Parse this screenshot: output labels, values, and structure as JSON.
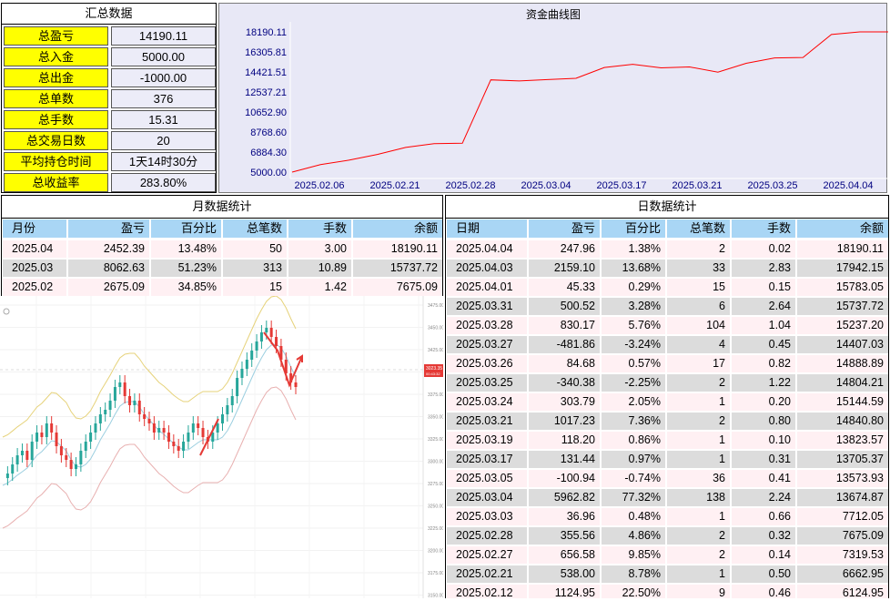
{
  "summary": {
    "title": "汇总数据",
    "rows": [
      {
        "label": "总盈亏",
        "value": "14190.11"
      },
      {
        "label": "总入金",
        "value": "5000.00"
      },
      {
        "label": "总出金",
        "value": "-1000.00"
      },
      {
        "label": "总单数",
        "value": "376"
      },
      {
        "label": "总手数",
        "value": "15.31"
      },
      {
        "label": "总交易日数",
        "value": "20"
      },
      {
        "label": "平均持仓时间",
        "value": "1天14时30分"
      },
      {
        "label": "总收益率",
        "value": "283.80%"
      }
    ]
  },
  "chart_data": {
    "type": "line",
    "title": "资金曲线图",
    "xlabel": "",
    "ylabel": "",
    "y_ticks": [
      "18190.11",
      "16305.81",
      "14421.51",
      "12537.21",
      "10652.90",
      "8768.60",
      "6884.30",
      "5000.00"
    ],
    "ylim": [
      5000.0,
      18190.11
    ],
    "x_ticks": [
      "2025.02.06",
      "2025.02.21",
      "2025.02.28",
      "2025.03.04",
      "2025.03.17",
      "2025.03.21",
      "2025.03.25",
      "2025.04.04"
    ],
    "x": [
      "2025.02.06",
      "2025.02.07",
      "2025.02.10",
      "2025.02.12",
      "2025.02.21",
      "2025.02.27",
      "2025.02.28",
      "2025.03.03",
      "2025.03.04",
      "2025.03.05",
      "2025.03.17",
      "2025.03.19",
      "2025.03.21",
      "2025.03.24",
      "2025.03.25",
      "2025.03.26",
      "2025.03.27",
      "2025.03.28",
      "2025.03.31",
      "2025.04.01",
      "2025.04.03",
      "2025.04.04"
    ],
    "values": [
      5000.0,
      5700.0,
      6124.95,
      6662.95,
      7319.53,
      7675.09,
      7712.05,
      13674.87,
      13573.93,
      13705.37,
      13823.57,
      14840.8,
      15144.59,
      14804.21,
      14888.89,
      14407.03,
      15237.2,
      15737.72,
      15783.05,
      17942.15,
      18190.11,
      18190.11
    ],
    "grid": false,
    "line_color": "#ff0000"
  },
  "monthly": {
    "title": "月数据统计",
    "headers": [
      "月份",
      "盈亏",
      "百分比",
      "总笔数",
      "手数",
      "余额"
    ],
    "rows": [
      [
        "2025.04",
        "2452.39",
        "13.48%",
        "50",
        "3.00",
        "18190.11"
      ],
      [
        "2025.03",
        "8062.63",
        "51.23%",
        "313",
        "10.89",
        "15737.72"
      ],
      [
        "2025.02",
        "2675.09",
        "34.85%",
        "15",
        "1.42",
        "7675.09"
      ]
    ]
  },
  "daily": {
    "title": "日数据统计",
    "headers": [
      "日期",
      "盈亏",
      "百分比",
      "总笔数",
      "手数",
      "余额"
    ],
    "rows": [
      [
        "2025.04.04",
        "247.96",
        "1.38%",
        "2",
        "0.02",
        "18190.11"
      ],
      [
        "2025.04.03",
        "2159.10",
        "13.68%",
        "33",
        "2.83",
        "17942.15"
      ],
      [
        "2025.04.01",
        "45.33",
        "0.29%",
        "15",
        "0.15",
        "15783.05"
      ],
      [
        "2025.03.31",
        "500.52",
        "3.28%",
        "6",
        "2.64",
        "15737.72"
      ],
      [
        "2025.03.28",
        "830.17",
        "5.76%",
        "104",
        "1.04",
        "15237.20"
      ],
      [
        "2025.03.27",
        "-481.86",
        "-3.24%",
        "4",
        "0.45",
        "14407.03"
      ],
      [
        "2025.03.26",
        "84.68",
        "0.57%",
        "17",
        "0.82",
        "14888.89"
      ],
      [
        "2025.03.25",
        "-340.38",
        "-2.25%",
        "2",
        "1.22",
        "14804.21"
      ],
      [
        "2025.03.24",
        "303.79",
        "2.05%",
        "1",
        "0.20",
        "15144.59"
      ],
      [
        "2025.03.21",
        "1017.23",
        "7.36%",
        "2",
        "0.80",
        "14840.80"
      ],
      [
        "2025.03.19",
        "118.20",
        "0.86%",
        "1",
        "0.10",
        "13823.57"
      ],
      [
        "2025.03.17",
        "131.44",
        "0.97%",
        "1",
        "0.31",
        "13705.37"
      ],
      [
        "2025.03.05",
        "-100.94",
        "-0.74%",
        "36",
        "0.41",
        "13573.93"
      ],
      [
        "2025.03.04",
        "5962.82",
        "77.32%",
        "138",
        "2.24",
        "13674.87"
      ],
      [
        "2025.03.03",
        "36.96",
        "0.48%",
        "1",
        "0.66",
        "7712.05"
      ],
      [
        "2025.02.28",
        "355.56",
        "4.86%",
        "2",
        "0.32",
        "7675.09"
      ],
      [
        "2025.02.27",
        "656.58",
        "9.85%",
        "2",
        "0.14",
        "7319.53"
      ],
      [
        "2025.02.21",
        "538.00",
        "8.78%",
        "1",
        "0.50",
        "6662.95"
      ],
      [
        "2025.02.12",
        "1124.95",
        "22.50%",
        "9",
        "0.46",
        "6124.95"
      ]
    ]
  },
  "kline": {
    "price_tag": "3023.35",
    "price_tag_sub": "00:43:32",
    "axis_labels": [
      "3475.00",
      "3450.00",
      "3425.00",
      "3400.00",
      "3375.00",
      "3350.00",
      "3325.00",
      "3300.00",
      "3275.00",
      "3250.00",
      "3225.00",
      "3200.00",
      "3175.00",
      "3150.00"
    ]
  }
}
